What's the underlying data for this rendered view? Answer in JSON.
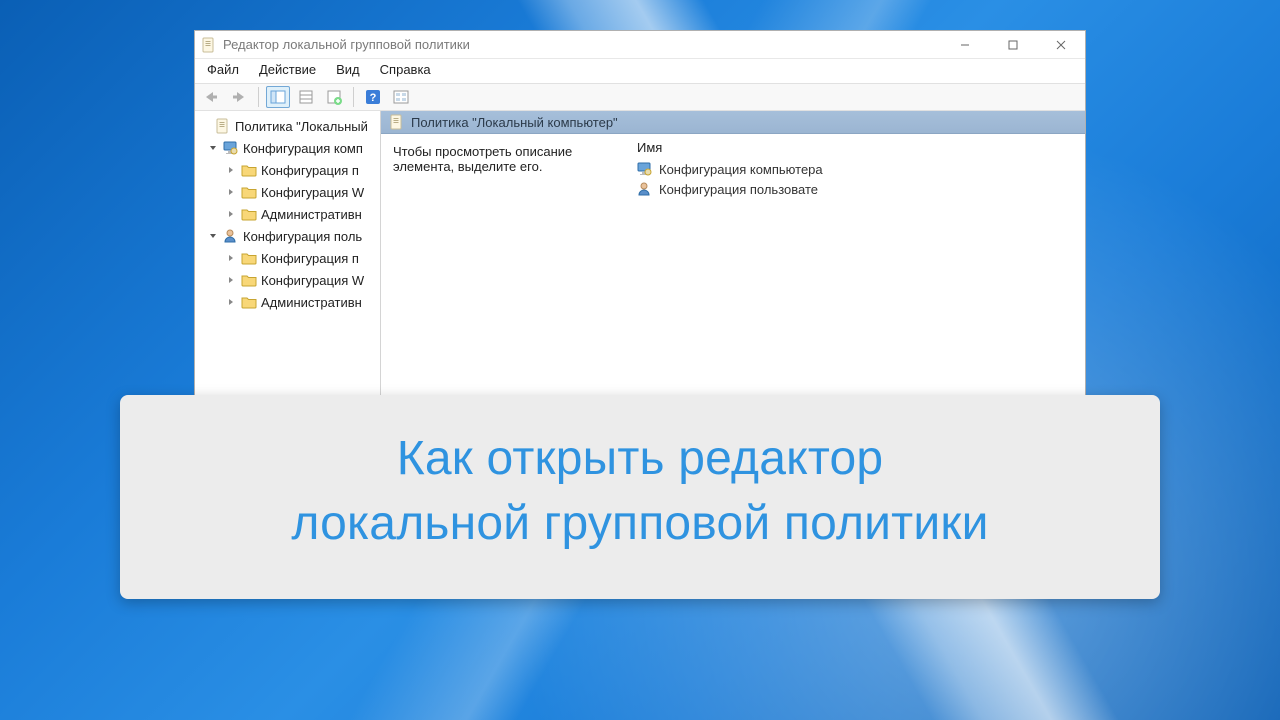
{
  "window": {
    "title": "Редактор локальной групповой политики"
  },
  "menu": {
    "file": "Файл",
    "action": "Действие",
    "view": "Вид",
    "help": "Справка"
  },
  "tree": {
    "root": "Политика \"Локальный",
    "computer_config": "Конфигурация комп",
    "user_config": "Конфигурация поль",
    "sub_program": "Конфигурация п",
    "sub_windows": "Конфигурация W",
    "sub_admin": "Административн"
  },
  "content": {
    "header": "Политика \"Локальный компьютер\"",
    "description": "Чтобы просмотреть описание элемента, выделите его.",
    "name_column": "Имя",
    "items": {
      "computer": "Конфигурация компьютера",
      "user": "Конфигурация пользовате"
    }
  },
  "caption": {
    "line1": "Как открыть редактор",
    "line2": "локальной групповой политики"
  }
}
